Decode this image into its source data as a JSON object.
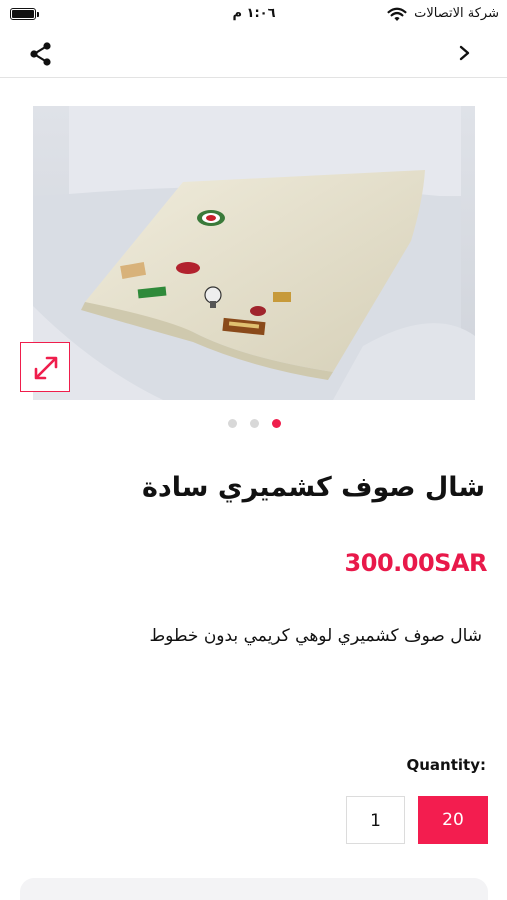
{
  "status_bar": {
    "time": "١:٠٦ م",
    "carrier": "شركة الاتصالات",
    "battery_level": 1.0
  },
  "nav": {
    "share_icon": "share-icon",
    "back_icon": "chevron-right-icon"
  },
  "gallery": {
    "image_count": 3,
    "active_index": 2,
    "expand_icon": "expand-arrows-icon"
  },
  "product": {
    "title": "شال صوف كشميري سادة",
    "price": "300.00SAR",
    "description": "شال صوف كشميري لوهي كريمي بدون خطوط"
  },
  "quantity": {
    "label": "Quantity:",
    "options": [
      "1",
      "20"
    ],
    "selected": "20"
  },
  "colors": {
    "accent": "#ef1e4c",
    "price": "#e8194a"
  }
}
